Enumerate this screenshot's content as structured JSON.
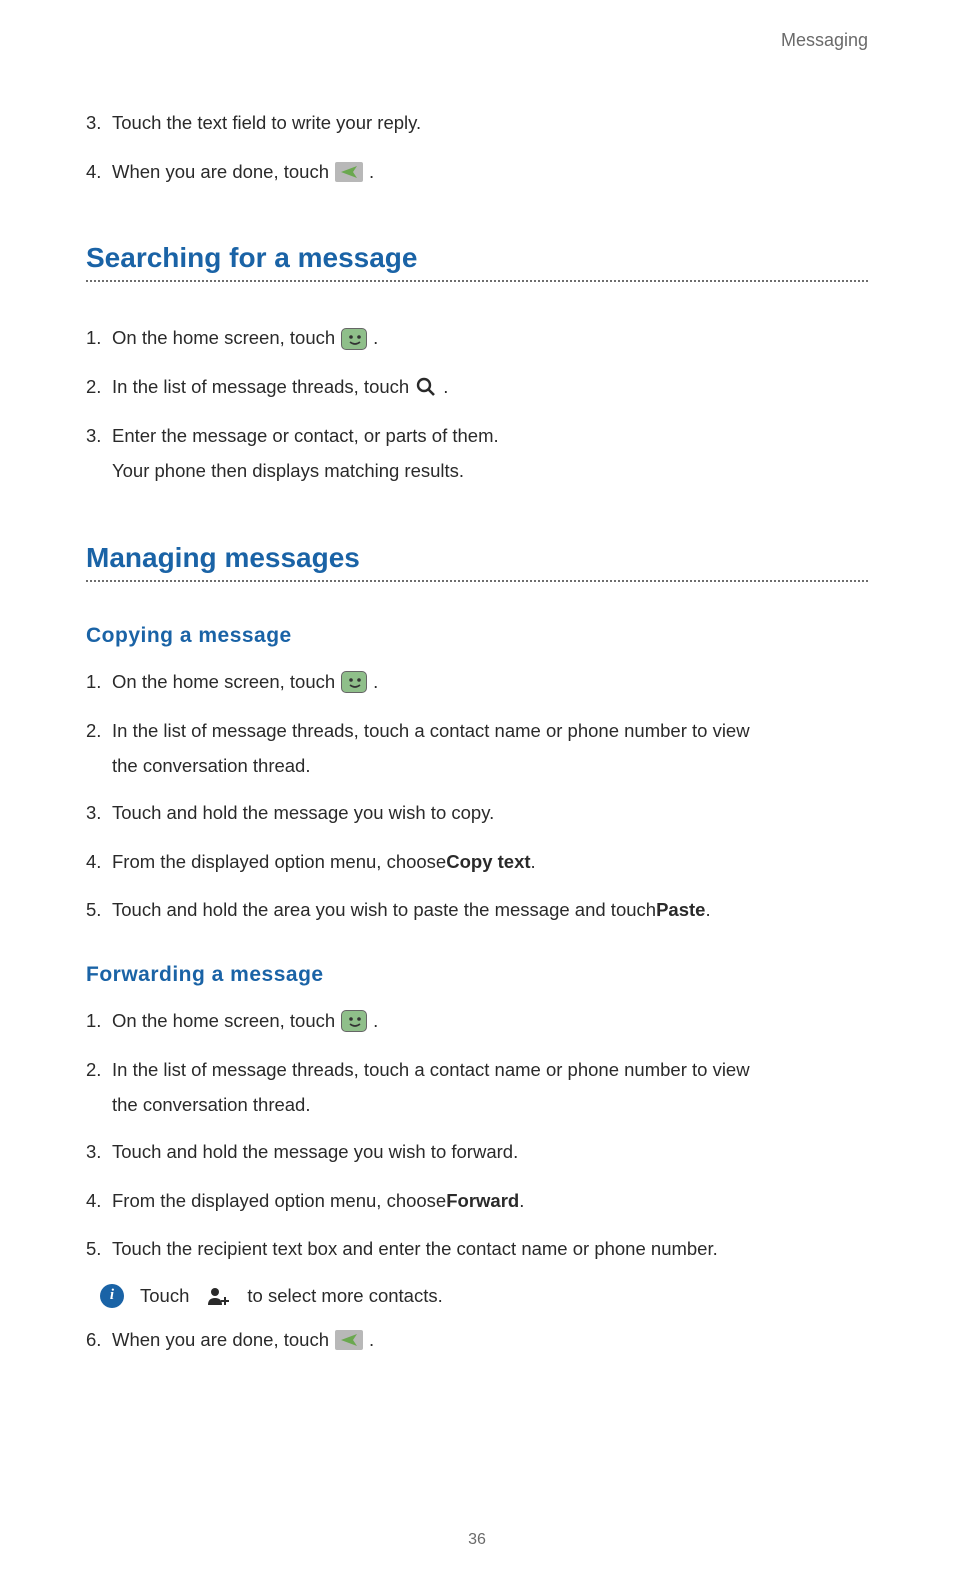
{
  "header": {
    "category": "Messaging"
  },
  "intro_steps": {
    "s3": {
      "num": "3.",
      "text": "Touch the text field to write your reply."
    },
    "s4": {
      "num": "4.",
      "pre": "When you are done, touch ",
      "post": "."
    }
  },
  "section_search": {
    "title": "Searching for a message",
    "s1": {
      "num": "1.",
      "pre": "On the home screen, touch ",
      "post": "."
    },
    "s2": {
      "num": "2.",
      "pre": "In the list of message threads, touch ",
      "post": "."
    },
    "s3": {
      "num": "3.",
      "text": "Enter the message or contact, or parts of them.",
      "cont": "Your phone then displays matching results."
    }
  },
  "section_manage": {
    "title": "Managing messages",
    "sub_copy": {
      "title": "Copying  a  message",
      "s1": {
        "num": "1.",
        "pre": "On the home screen, touch ",
        "post": "."
      },
      "s2": {
        "num": "2.",
        "text": "In the list of message threads, touch a contact name or phone number to view",
        "cont": "the conversation thread."
      },
      "s3": {
        "num": "3.",
        "text": "Touch and hold the message you wish to copy."
      },
      "s4": {
        "num": "4.",
        "pre": "From the displayed option menu, choose ",
        "bold": "Copy text",
        "post": "."
      },
      "s5": {
        "num": "5.",
        "pre": "Touch and hold the area you wish to paste the message and touch ",
        "bold": "Paste",
        "post": "."
      }
    },
    "sub_forward": {
      "title": "Forwarding  a  message",
      "s1": {
        "num": "1.",
        "pre": "On the home screen, touch ",
        "post": "."
      },
      "s2": {
        "num": "2.",
        "text": "In the list of message threads, touch a contact name or phone number to view",
        "cont": "the conversation thread."
      },
      "s3": {
        "num": "3.",
        "text": "Touch and hold the message you wish to forward."
      },
      "s4": {
        "num": "4.",
        "pre": "From the displayed option menu, choose ",
        "bold": "Forward",
        "post": "."
      },
      "s5": {
        "num": "5.",
        "text": "Touch the recipient text box and enter the contact name or phone number."
      },
      "tip": {
        "pre": "Touch ",
        "post": " to select more contacts."
      },
      "s6": {
        "num": "6.",
        "pre": "When you are done, touch ",
        "post": "."
      }
    }
  },
  "page_number": "36",
  "icons": {
    "send": "send-icon",
    "messaging_app": "messaging-smile-icon",
    "search": "search-icon",
    "info": "info-icon",
    "add_contact": "person-plus-icon"
  },
  "info_symbol": "i"
}
